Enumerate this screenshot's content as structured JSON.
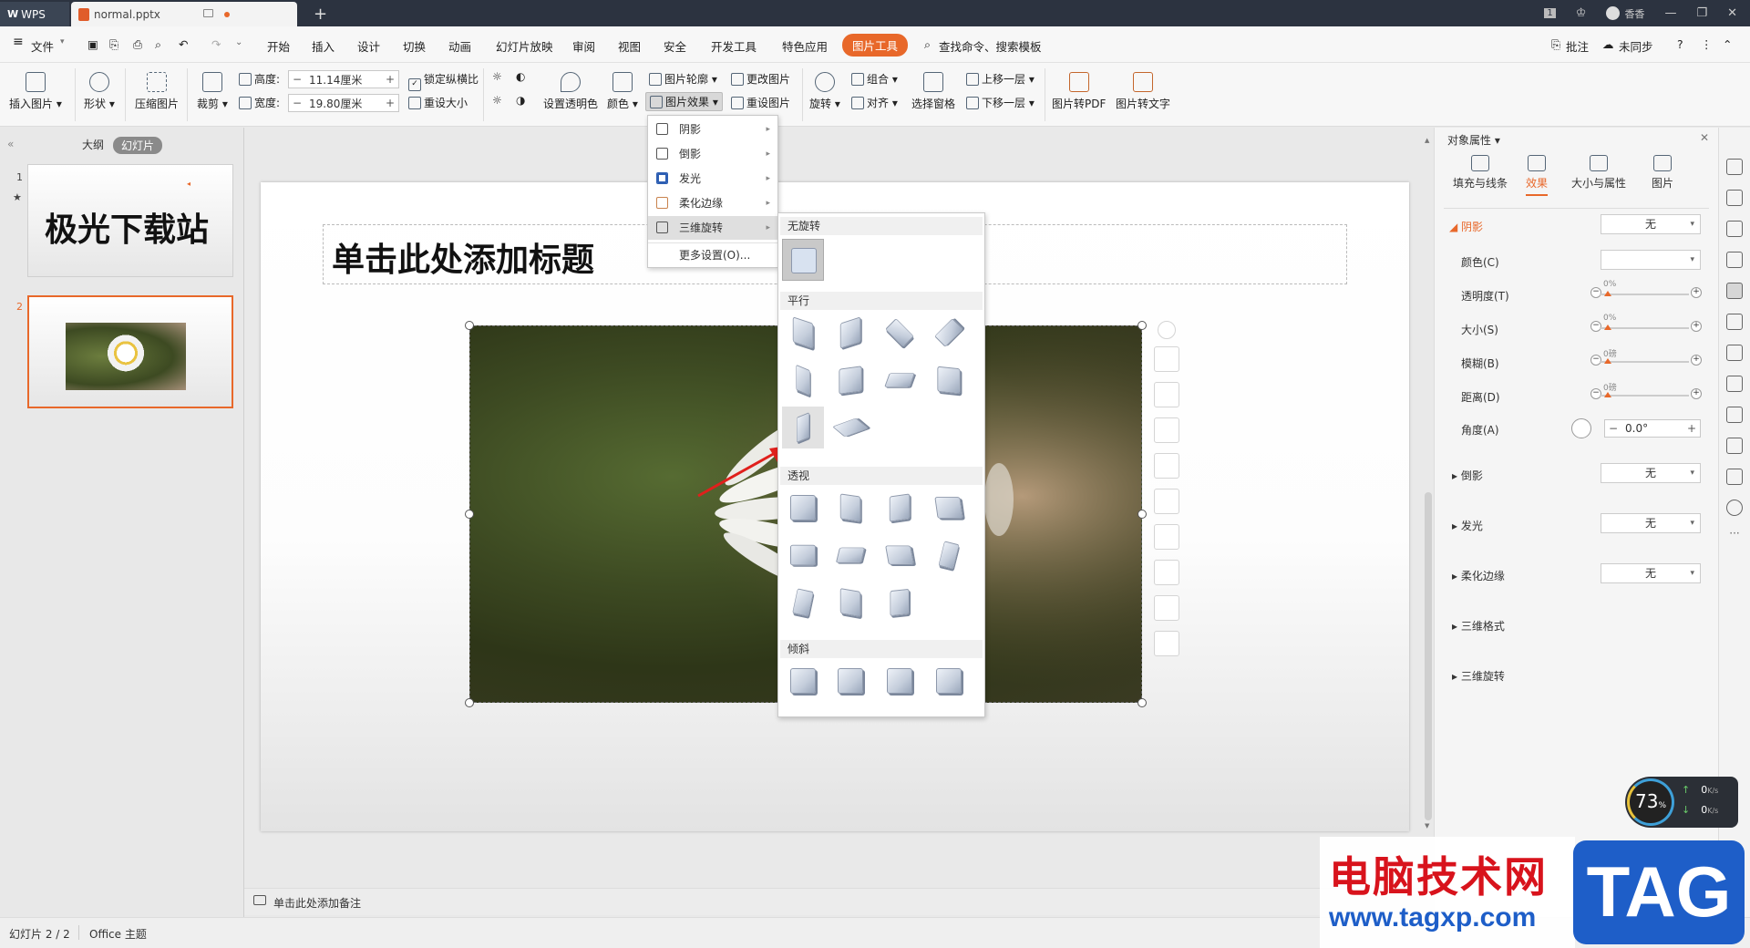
{
  "tabs": {
    "app": "WPS",
    "file": "normal.pptx",
    "new_tab": "+"
  },
  "window": {
    "user": "香香"
  },
  "menu": {
    "file": "文件",
    "items": [
      "开始",
      "插入",
      "设计",
      "切换",
      "动画",
      "幻灯片放映",
      "审阅",
      "视图",
      "安全",
      "开发工具",
      "特色应用",
      "图片工具"
    ],
    "search": "查找命令、搜索模板",
    "annotate": "批注",
    "sync": "未同步"
  },
  "ribbon": {
    "insert_picture": "插入图片",
    "shape": "形状",
    "compress": "压缩图片",
    "crop": "裁剪",
    "height_label": "高度:",
    "height_value": "11.14厘米",
    "width_label": "宽度:",
    "width_value": "19.80厘米",
    "lock_ratio": "锁定纵横比",
    "reset_size": "重设大小",
    "transparent": "设置透明色",
    "color": "颜色",
    "outline": "图片轮廓",
    "effects": "图片效果",
    "change": "更改图片",
    "reset": "重设图片",
    "rotate": "旋转",
    "group": "组合",
    "align": "对齐",
    "select_pane": "选择窗格",
    "bring_forward": "上移一层",
    "send_backward": "下移一层",
    "to_pdf": "图片转PDF",
    "to_text": "图片转文字"
  },
  "left_panel": {
    "tab_outline": "大纲",
    "tab_slides": "幻灯片",
    "slide1_num": "1",
    "slide1_text": "极光下载站",
    "slide2_num": "2"
  },
  "slide": {
    "title_placeholder": "单击此处添加标题"
  },
  "effects_menu": {
    "items": [
      "阴影",
      "倒影",
      "发光",
      "柔化边缘",
      "三维旋转"
    ],
    "more": "更多设置(O)..."
  },
  "rotation_menu": {
    "no_rotation": "无旋转",
    "parallel": "平行",
    "perspective": "透视",
    "oblique": "倾斜"
  },
  "notes": {
    "placeholder": "单击此处添加备注"
  },
  "status": {
    "slide_count": "幻灯片 2 / 2",
    "theme": "Office 主题"
  },
  "right_panel": {
    "title": "对象属性",
    "tabs": [
      "填充与线条",
      "效果",
      "大小与属性",
      "图片"
    ],
    "shadow": "阴影",
    "shadow_value": "无",
    "color": "颜色(C)",
    "transparency": "透明度(T)",
    "size": "大小(S)",
    "blur": "模糊(B)",
    "distance": "距离(D)",
    "angle": "角度(A)",
    "transparency_val": "0%",
    "size_val": "0%",
    "blur_val": "0磅",
    "distance_val": "0磅",
    "angle_val": "0.0°",
    "reflection": "倒影",
    "reflection_value": "无",
    "glow": "发光",
    "glow_value": "无",
    "soft_edges": "柔化边缘",
    "soft_edges_value": "无",
    "format3d": "三维格式",
    "rotation3d": "三维旋转"
  },
  "widget": {
    "percent": "73",
    "unit": "%",
    "up": "0",
    "down": "0",
    "speed_unit": "K/s"
  },
  "watermark": {
    "site": "电脑技术网",
    "url": "www.tagxp.com",
    "logo": "TAG"
  },
  "colors": {
    "accent": "#e8682a",
    "tabbar": "#2c3340",
    "watermark_red": "#d8131c",
    "watermark_blue": "#1e5ec8"
  }
}
